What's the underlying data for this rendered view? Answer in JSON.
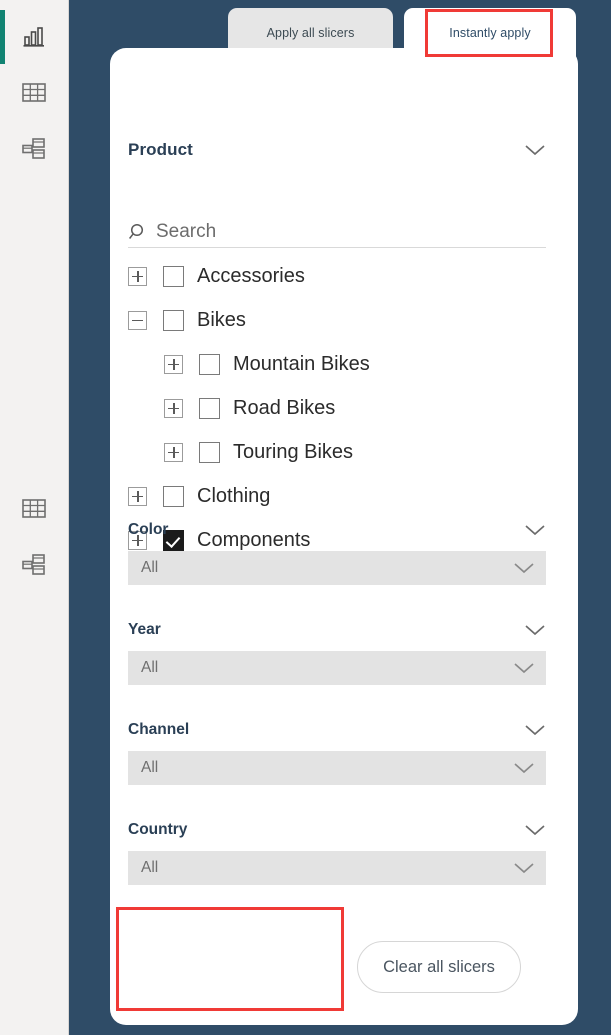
{
  "nav_rail": {
    "items": [
      {
        "name": "report-view",
        "icon": "bar-chart-icon",
        "active": true
      },
      {
        "name": "data-view",
        "icon": "table-icon",
        "active": false
      },
      {
        "name": "model-view",
        "icon": "model-relationships-icon",
        "active": false
      },
      {
        "name": "data-view-2",
        "icon": "table-icon",
        "active": false
      },
      {
        "name": "model-view-2",
        "icon": "model-relationships-icon",
        "active": false
      }
    ]
  },
  "tabs": [
    {
      "label": "Apply all slicers",
      "active": false
    },
    {
      "label": "Instantly apply",
      "active": true
    }
  ],
  "product_slicer": {
    "title": "Product",
    "chevron_icon": "chevron-down-icon",
    "search": {
      "placeholder": "Search",
      "value": "",
      "icon": "search-icon"
    },
    "tree": [
      {
        "label": "Accessories",
        "level": 0,
        "expander": "plus",
        "checked": false
      },
      {
        "label": "Bikes",
        "level": 0,
        "expander": "minus",
        "checked": false
      },
      {
        "label": "Mountain Bikes",
        "level": 1,
        "expander": "plus",
        "checked": false
      },
      {
        "label": "Road Bikes",
        "level": 1,
        "expander": "plus",
        "checked": false
      },
      {
        "label": "Touring Bikes",
        "level": 1,
        "expander": "plus",
        "checked": false
      },
      {
        "label": "Clothing",
        "level": 0,
        "expander": "plus",
        "checked": false
      },
      {
        "label": "Components",
        "level": 0,
        "expander": "plus",
        "checked": true
      }
    ]
  },
  "dropdown_slicers": [
    {
      "title": "Color",
      "value": "All",
      "chevron_icon": "chevron-down-icon"
    },
    {
      "title": "Year",
      "value": "All",
      "chevron_icon": "chevron-down-icon"
    },
    {
      "title": "Channel",
      "value": "All",
      "chevron_icon": "chevron-down-icon"
    },
    {
      "title": "Country",
      "value": "All",
      "chevron_icon": "chevron-down-icon"
    }
  ],
  "clear_button": {
    "label": "Clear all slicers"
  },
  "annotations": [
    {
      "name": "tab-highlight",
      "target": "Instantly apply"
    },
    {
      "name": "empty-area-highlight",
      "target": ""
    }
  ],
  "colors": {
    "canvas_navy": "#2f4c67",
    "rail_bg": "#f3f2f1",
    "active_accent": "#118372",
    "card_bg": "#ffffff",
    "tab_inactive_bg": "#e6e6e6",
    "dropdown_bg": "#e3e3e3",
    "annotation_red": "#f03a36",
    "title_color": "#2a3f55"
  }
}
